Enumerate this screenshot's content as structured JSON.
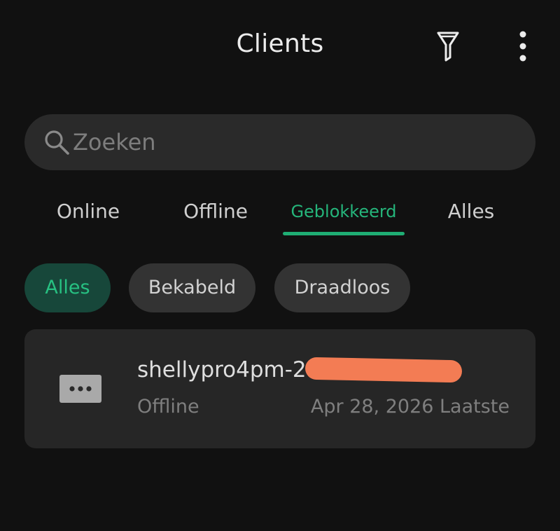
{
  "header": {
    "title": "Clients",
    "filter_icon": "filter-icon",
    "more_icon": "more-vertical-icon"
  },
  "search": {
    "placeholder": "Zoeken",
    "value": "",
    "icon": "search-icon"
  },
  "tabs": [
    {
      "label": "Online",
      "active": false
    },
    {
      "label": "Offline",
      "active": false
    },
    {
      "label": "Geblokkeerd",
      "active": true
    },
    {
      "label": "Alles",
      "active": false
    }
  ],
  "filters": [
    {
      "label": "Alles",
      "active": true
    },
    {
      "label": "Bekabeld",
      "active": false
    },
    {
      "label": "Draadloos",
      "active": false
    }
  ],
  "clients": [
    {
      "name": "shellypro4pm-2",
      "status": "Offline",
      "last_seen": "Apr 28, 2026 Laatste",
      "icon": "unknown-device-icon",
      "name_redacted": true
    }
  ],
  "colors": {
    "accent": "#1fae74",
    "background": "#111111",
    "redaction": "#f37c54"
  }
}
